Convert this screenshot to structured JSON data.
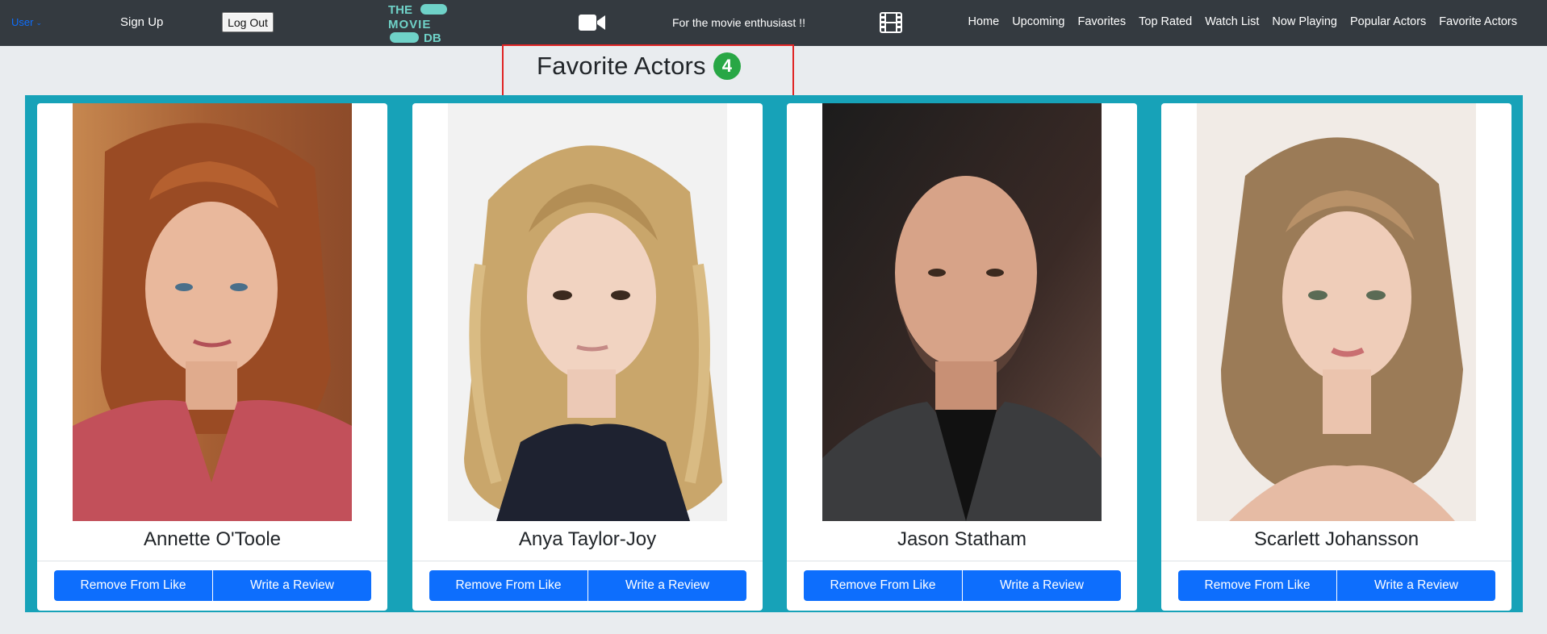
{
  "navbar": {
    "user_label": "User",
    "signup_label": "Sign Up",
    "logout_label": "Log Out",
    "logo": {
      "line1": "THE",
      "line2": "MOVIE",
      "line3": "DB"
    },
    "tagline": "For the movie enthusiast !!",
    "links": [
      "Home",
      "Upcoming",
      "Favorites",
      "Top Rated",
      "Watch List",
      "Now Playing",
      "Popular Actors",
      "Favorite Actors"
    ]
  },
  "page": {
    "title": "Favorite Actors",
    "count": "4"
  },
  "actors": [
    {
      "name": "Annette O'Toole",
      "remove_label": "Remove From Like",
      "review_label": "Write a Review"
    },
    {
      "name": "Anya Taylor-Joy",
      "remove_label": "Remove From Like",
      "review_label": "Write a Review"
    },
    {
      "name": "Jason Statham",
      "remove_label": "Remove From Like",
      "review_label": "Write a Review"
    },
    {
      "name": "Scarlett Johansson",
      "remove_label": "Remove From Like",
      "review_label": "Write a Review"
    }
  ],
  "colors": {
    "navbar_bg": "#343a40",
    "page_bg": "#e9ecef",
    "panel_bg": "#17a2b8",
    "button_primary": "#0d6efd",
    "badge_success": "#28a745",
    "highlight_border": "#e02424",
    "logo_teal": "#6fd2c8"
  },
  "icons": [
    "chevron-down-icon",
    "video-camera-icon",
    "film-strip-icon"
  ]
}
